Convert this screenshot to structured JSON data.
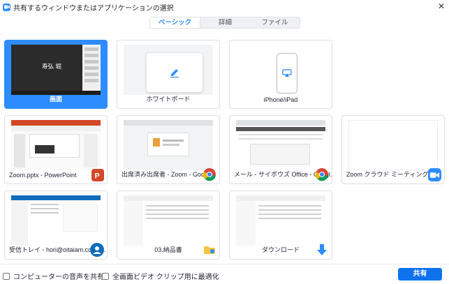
{
  "window": {
    "title": "共有するウィンドウまたはアプリケーションの選択",
    "close_glyph": "✕"
  },
  "tabs": [
    {
      "label": "ベーシック",
      "active": true
    },
    {
      "label": "詳細",
      "active": false
    },
    {
      "label": "ファイル",
      "active": false
    }
  ],
  "tiles": [
    {
      "label": "画面",
      "kind": "screen",
      "selected": true,
      "thumb_text": "寿弘 堀"
    },
    {
      "label": "ホワイトボード",
      "kind": "whiteboard",
      "icon": "pencil-icon"
    },
    {
      "label": "iPhone/iPad",
      "kind": "iphone",
      "icon": "airplay-icon"
    },
    {
      "label": "Zoom.pptx - PowerPoint",
      "kind": "app",
      "badge": "powerpoint-icon"
    },
    {
      "label": "出席済み出席者 - Zoom - Googl...",
      "kind": "app",
      "badge": "chrome-icon"
    },
    {
      "label": "メール - サイボウズ Office - Googl...",
      "kind": "app",
      "badge": "chrome-icon"
    },
    {
      "label": "Zoom クラウド ミーティング",
      "kind": "app",
      "badge": "zoom-icon"
    },
    {
      "label": "受信トレイ - hori@oitaiam.com -...",
      "kind": "app",
      "badge": "mail-icon"
    },
    {
      "label": "03.納品書",
      "kind": "app",
      "badge": "folder-icon"
    },
    {
      "label": "ダウンロード",
      "kind": "app",
      "badge": "download-icon"
    }
  ],
  "bottom": {
    "share_audio": "コンピューターの音声を共有",
    "optimize_video": "全画面ビデオ クリップ用に最適化",
    "share_button": "共有"
  },
  "colors": {
    "accent": "#2d8cff",
    "button": "#0e72ed"
  }
}
